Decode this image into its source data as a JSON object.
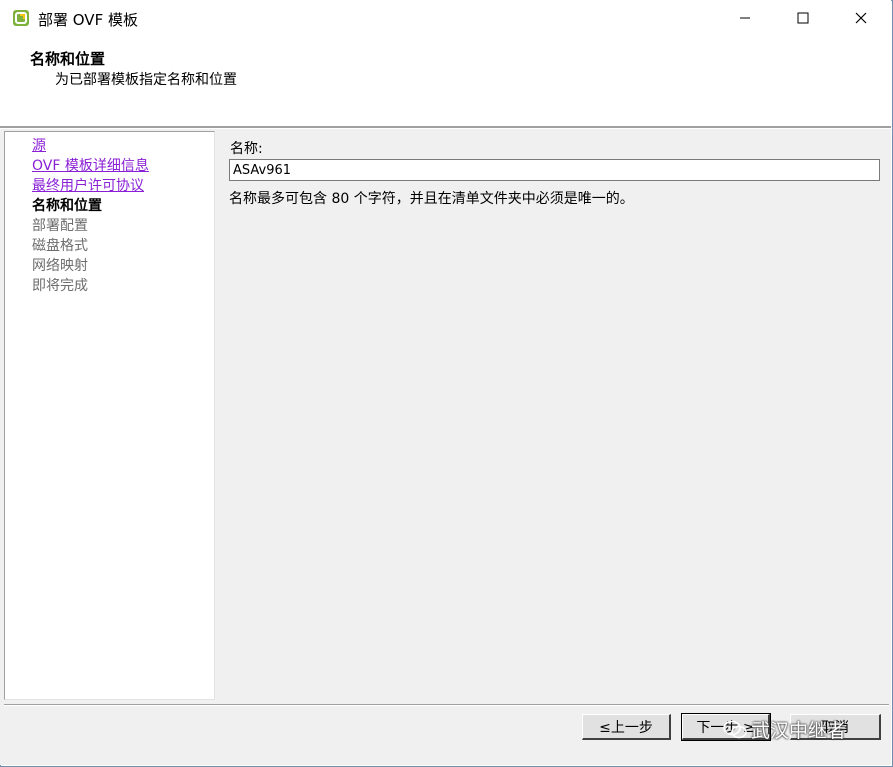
{
  "window": {
    "title": "部署 OVF 模板",
    "controls": {
      "minimize": "—",
      "maximize": "☐",
      "close": "✕"
    }
  },
  "header": {
    "title": "名称和位置",
    "subtitle": "为已部署模板指定名称和位置"
  },
  "nav": {
    "items": [
      {
        "label": "源",
        "state": "link"
      },
      {
        "label": "OVF 模板详细信息",
        "state": "link"
      },
      {
        "label": "最终用户许可协议",
        "state": "link"
      },
      {
        "label": "名称和位置",
        "state": "current"
      },
      {
        "label": "部署配置",
        "state": "disabled"
      },
      {
        "label": "磁盘格式",
        "state": "disabled"
      },
      {
        "label": "网络映射",
        "state": "disabled"
      },
      {
        "label": "即将完成",
        "state": "disabled"
      }
    ]
  },
  "form": {
    "name_label": "名称:",
    "name_value": "ASAv961",
    "hint": "名称最多可包含 80 个字符，并且在清单文件夹中必须是唯一的。"
  },
  "footer": {
    "back_label": "≤上一步",
    "next_label": "下一步 ≥",
    "cancel_label": "取消"
  },
  "watermark": {
    "text": "武汉中继者"
  },
  "colors": {
    "link": "#8b1fd6",
    "disabled": "#6d6d6d",
    "panel": "#f0f0f0"
  }
}
